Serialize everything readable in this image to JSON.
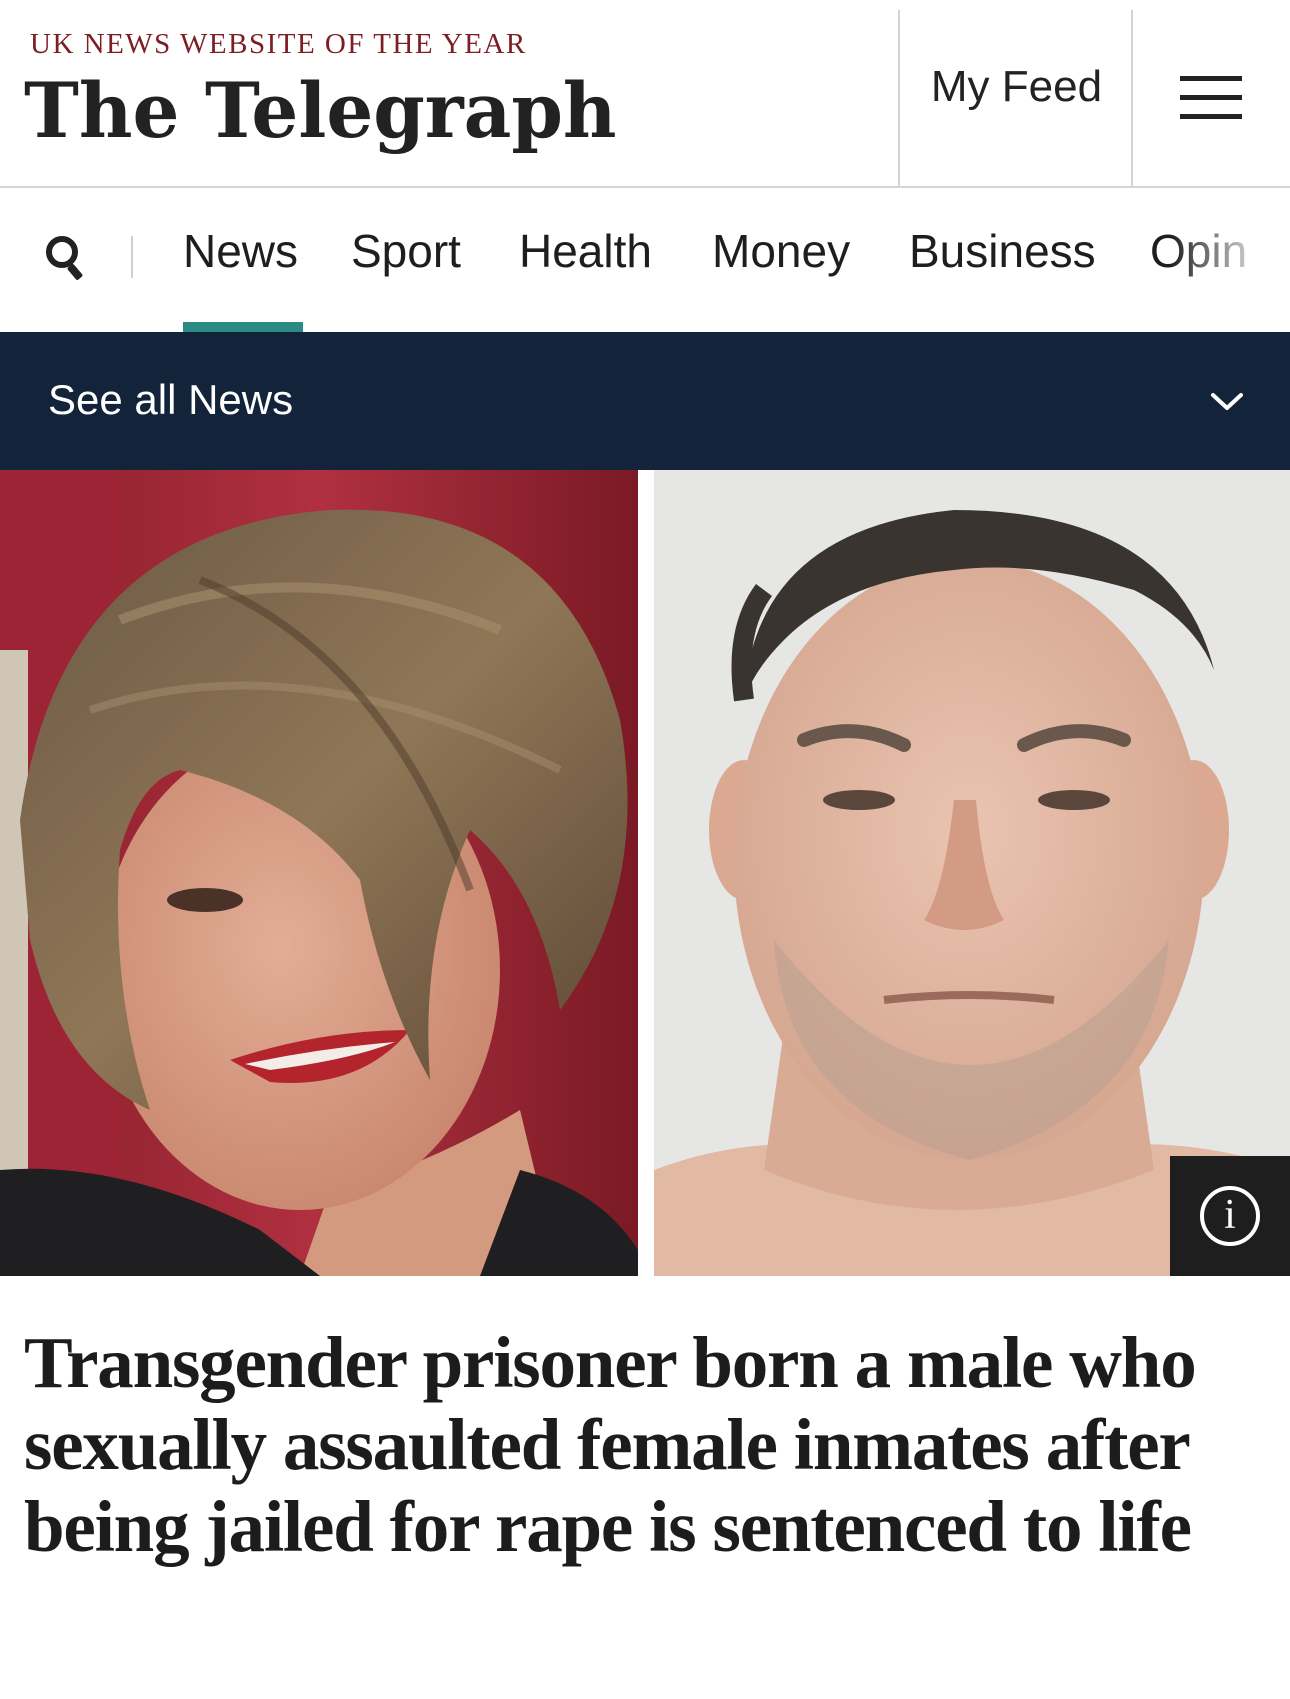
{
  "masthead": {
    "tagline": "UK NEWS WEBSITE OF THE YEAR",
    "logo_text": "The Telegraph",
    "my_feed_label": "My Feed",
    "menu_icon": "hamburger-menu-icon",
    "tagline_color": "#7d1d24"
  },
  "nav": {
    "search_icon": "search-icon",
    "items": [
      {
        "label": "News",
        "active": true
      },
      {
        "label": "Sport"
      },
      {
        "label": "Health"
      },
      {
        "label": "Money"
      },
      {
        "label": "Business"
      },
      {
        "label": "Opin"
      }
    ],
    "active_color": "#2b8b84"
  },
  "section_bar": {
    "label": "See all News",
    "icon": "chevron-down-icon",
    "background": "#12233a"
  },
  "hero": {
    "info_icon": "info-icon",
    "info_glyph": "i"
  },
  "article": {
    "headline": "Transgender prisoner born a male who sexually assaulted female inmates after being jailed for rape is sentenced to life"
  }
}
